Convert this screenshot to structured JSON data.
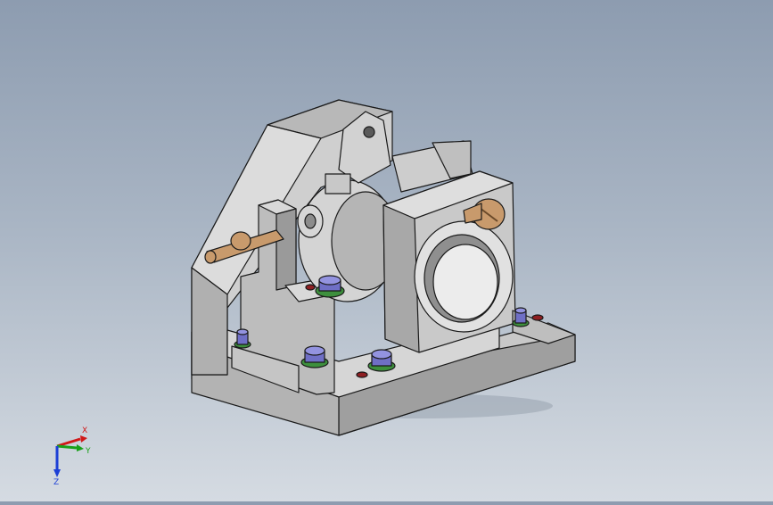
{
  "viewport": {
    "background_top": "#8d9cb0",
    "background_bottom": "#d5dbe2",
    "model_colors": {
      "body_light": "#c9c9c9",
      "body_mid": "#a9a9a9",
      "body_dark": "#6d6d6d",
      "edge": "#1a1a1a",
      "pin": "#c89a6c",
      "bolt": "#6f6fc6",
      "hole": "#8e1f22"
    }
  },
  "triad": {
    "x_label": "X",
    "y_label": "Y",
    "z_label": "Z",
    "x_color": "#d01818",
    "y_color": "#19a019",
    "z_color": "#1c3fd6"
  }
}
